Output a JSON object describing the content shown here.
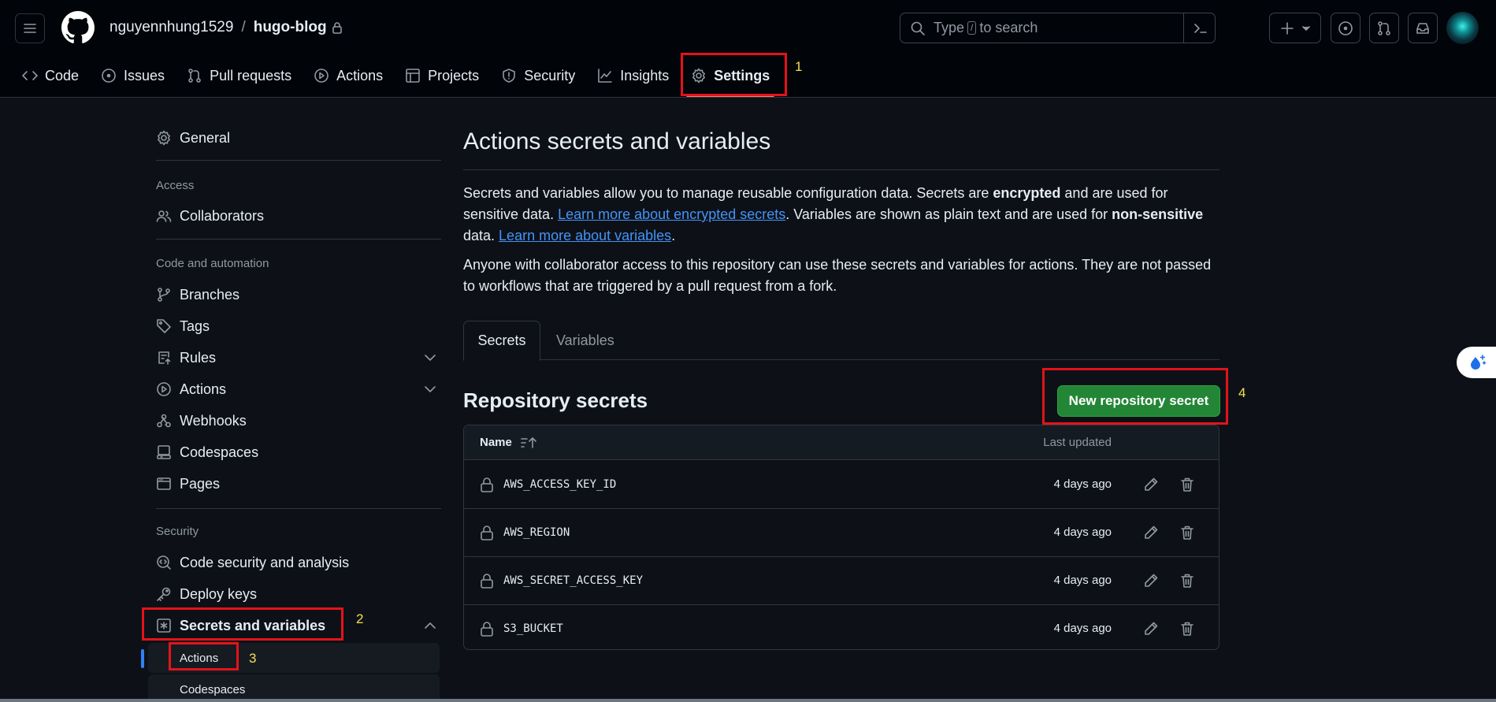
{
  "header": {
    "owner": "nguyennhung1529",
    "separator": "/",
    "repo": "hugo-blog",
    "search": {
      "prefix": "Type",
      "key": "/",
      "suffix": "to search"
    }
  },
  "tabs": [
    {
      "label": "Code",
      "icon": "code-icon"
    },
    {
      "label": "Issues",
      "icon": "issue-icon"
    },
    {
      "label": "Pull requests",
      "icon": "pull-request-icon"
    },
    {
      "label": "Actions",
      "icon": "play-icon"
    },
    {
      "label": "Projects",
      "icon": "table-icon"
    },
    {
      "label": "Security",
      "icon": "shield-icon"
    },
    {
      "label": "Insights",
      "icon": "graph-icon"
    },
    {
      "label": "Settings",
      "icon": "gear-icon",
      "active": true
    }
  ],
  "annotations": {
    "n1": "1",
    "n2": "2",
    "n3": "3",
    "n4": "4",
    "color": "#e3131b",
    "number_color": "#f4e04d"
  },
  "sidebar": {
    "general": "General",
    "access_heading": "Access",
    "collaborators": "Collaborators",
    "code_heading": "Code and automation",
    "branches": "Branches",
    "tags": "Tags",
    "rules": "Rules",
    "actions": "Actions",
    "webhooks": "Webhooks",
    "codespaces": "Codespaces",
    "pages": "Pages",
    "security_heading": "Security",
    "code_security": "Code security and analysis",
    "deploy_keys": "Deploy keys",
    "secrets_vars": "Secrets and variables",
    "sub_actions": "Actions",
    "sub_codespaces": "Codespaces"
  },
  "main": {
    "title": "Actions secrets and variables",
    "p1": {
      "a": "Secrets and variables allow you to manage reusable configuration data. Secrets are ",
      "b": "encrypted",
      "c": " and are used for sensitive data. ",
      "link1": "Learn more about encrypted secrets",
      "d": ". Variables are shown as plain text and are used for ",
      "e": "non-sensitive",
      "f": " data. ",
      "link2": "Learn more about variables",
      "g": "."
    },
    "p2": "Anyone with collaborator access to this repository can use these secrets and variables for actions. They are not passed to workflows that are triggered by a pull request from a fork.",
    "tab_secrets": "Secrets",
    "tab_variables": "Variables",
    "section_title": "Repository secrets",
    "new_button": "New repository secret",
    "table": {
      "col_name": "Name",
      "col_updated": "Last updated",
      "rows": [
        {
          "name": "AWS_ACCESS_KEY_ID",
          "updated": "4 days ago"
        },
        {
          "name": "AWS_REGION",
          "updated": "4 days ago"
        },
        {
          "name": "AWS_SECRET_ACCESS_KEY",
          "updated": "4 days ago"
        },
        {
          "name": "S3_BUCKET",
          "updated": "4 days ago"
        }
      ]
    }
  },
  "colors": {
    "accent_green": "#238636",
    "link": "#4493f8",
    "active_tab": "#f78166"
  }
}
